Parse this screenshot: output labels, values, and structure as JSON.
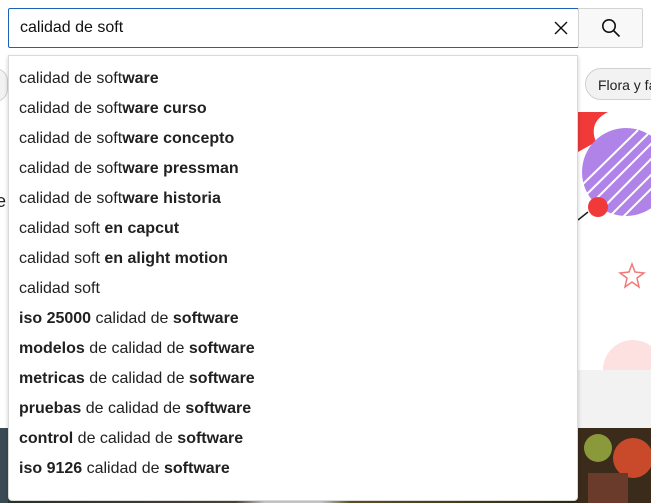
{
  "search": {
    "value": "calidad de soft",
    "clear_icon": "close-icon",
    "search_icon": "search-icon"
  },
  "background": {
    "right_chip_label": "Flora y fa",
    "left_letter": "e"
  },
  "suggestions": [
    {
      "plain": "calidad de soft",
      "bold": "ware",
      "tail_plain": "",
      "tail_bold": ""
    },
    {
      "plain": "calidad de soft",
      "bold": "ware curso",
      "tail_plain": "",
      "tail_bold": ""
    },
    {
      "plain": "calidad de soft",
      "bold": "ware concepto",
      "tail_plain": "",
      "tail_bold": ""
    },
    {
      "plain": "calidad de soft",
      "bold": "ware pressman",
      "tail_plain": "",
      "tail_bold": ""
    },
    {
      "plain": "calidad de soft",
      "bold": "ware historia",
      "tail_plain": "",
      "tail_bold": ""
    },
    {
      "plain": "calidad soft ",
      "bold": "en capcut",
      "tail_plain": "",
      "tail_bold": ""
    },
    {
      "plain": "calidad soft ",
      "bold": "en alight motion",
      "tail_plain": "",
      "tail_bold": ""
    },
    {
      "plain": "calidad soft",
      "bold": "",
      "tail_plain": "",
      "tail_bold": ""
    },
    {
      "lead_bold": "iso 25000",
      "plain": " calidad de ",
      "bold": "software"
    },
    {
      "lead_bold": "modelos",
      "plain": " de calidad de ",
      "bold": "software"
    },
    {
      "lead_bold": "metricas",
      "plain": " de calidad de ",
      "bold": "software"
    },
    {
      "lead_bold": "pruebas",
      "plain": " de calidad de ",
      "bold": "software"
    },
    {
      "lead_bold": "control",
      "plain": " de calidad de ",
      "bold": "software"
    },
    {
      "lead_bold": "iso 9126",
      "plain": " calidad de ",
      "bold": "software"
    }
  ],
  "colors": {
    "focus_border": "#1c62b9",
    "art_red": "#f03a3a",
    "art_purple": "#b083e8"
  }
}
